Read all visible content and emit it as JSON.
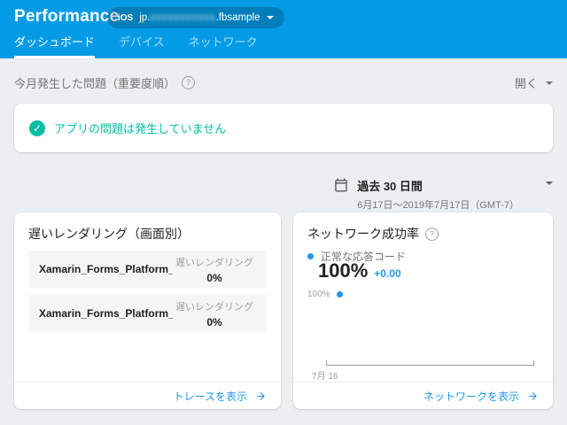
{
  "header": {
    "title": "Performance",
    "app_selector": {
      "platform": "iOS",
      "app_id_prefix": "jp.",
      "app_id_censored_placeholder": "xxxxxxxxxxx",
      "app_id_suffix": ".fbsample"
    },
    "tabs": [
      {
        "label": "ダッシュボード",
        "active": true
      },
      {
        "label": "デバイス",
        "active": false
      },
      {
        "label": "ネットワーク",
        "active": false
      }
    ]
  },
  "issues_section": {
    "title": "今月発生した問題（重要度順）",
    "help_glyph": "?",
    "toggle_label": "開く",
    "empty_message": "アプリの問題は発生していません",
    "check_glyph": "✓"
  },
  "date_range": {
    "preset": "過去 30 日間",
    "detail": "6月17日～2019年7月17日（GMT-7）"
  },
  "rendering_card": {
    "title": "遅いレンダリング（画面別）",
    "rows": [
      {
        "name": "Xamarin_Forms_Platform_iOS…",
        "metric_label": "遅いレンダリング",
        "value": "0%"
      },
      {
        "name": "Xamarin_Forms_Platform_iOS…",
        "metric_label": "遅いレンダリング",
        "value": "0%"
      }
    ],
    "footer_link": "トレースを表示"
  },
  "network_card": {
    "title": "ネットワーク成功率",
    "help_glyph": "?",
    "legend_label": "正常な応答コード",
    "value": "100%",
    "delta": "+0.00",
    "y_tick": "100%",
    "x_tick": "7月 16",
    "footer_link": "ネットワークを表示"
  },
  "chart_data": {
    "type": "line",
    "title": "ネットワーク成功率",
    "series": [
      {
        "name": "正常な応答コード",
        "x": [
          "7月16"
        ],
        "values": [
          100.0
        ]
      }
    ],
    "current_value_pct": 100.0,
    "delta": "+0.00",
    "y_ticks": [
      "100%"
    ],
    "x_ticks": [
      "7月 16"
    ],
    "ylim": [
      null,
      100
    ],
    "grid": false,
    "legend_position": "top-left"
  },
  "colors": {
    "header_blue": "#039be5",
    "accent_blue": "#2196f3",
    "success_teal": "#00bfa5",
    "page_bg": "#eceff1",
    "row_bg": "#f5f5f5"
  }
}
